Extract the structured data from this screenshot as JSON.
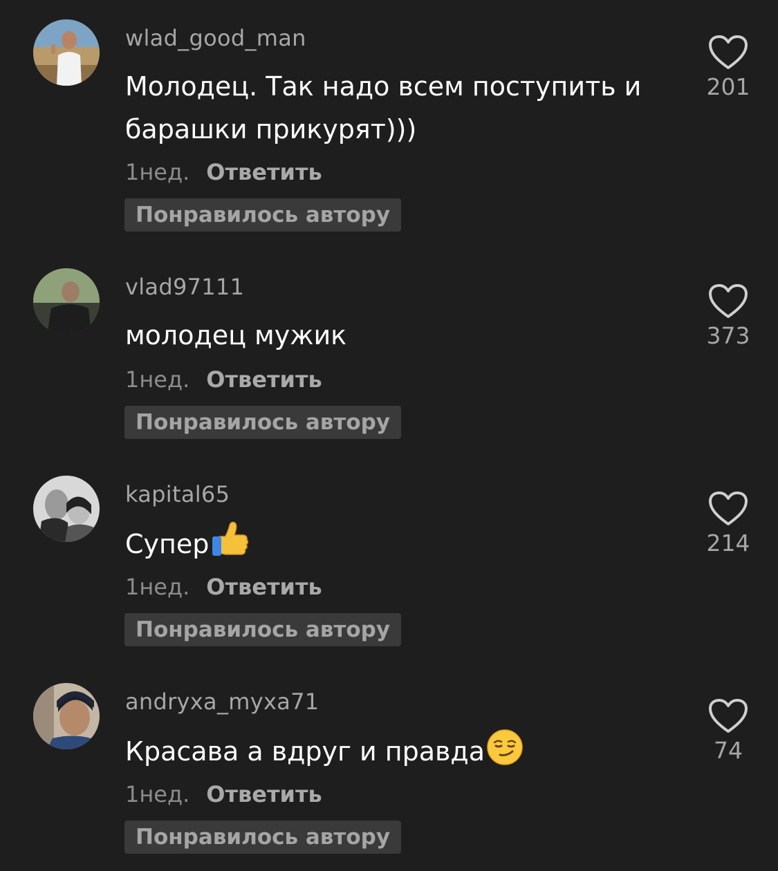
{
  "comments": [
    {
      "username": "wlad_good_man",
      "text": "Молодец. Так надо всем поступить и барашки прикурят)))",
      "emoji": "",
      "time": "1нед.",
      "reply_label": "Ответить",
      "badge": "Понравилось автору",
      "likes": "201",
      "avatar": "avatar-photo"
    },
    {
      "username": "vlad97111",
      "text": "молодец мужик",
      "emoji": "",
      "time": "1нед.",
      "reply_label": "Ответить",
      "badge": "Понравилось автору",
      "likes": "373",
      "avatar": "avatar-photo"
    },
    {
      "username": "kapital65",
      "text": "Супер",
      "emoji": "thumbs-up-emoji",
      "time": "1нед.",
      "reply_label": "Ответить",
      "badge": "Понравилось автору",
      "likes": "214",
      "avatar": "avatar-photo"
    },
    {
      "username": "andryxa_myxa71",
      "text": "Красава а вдруг и правда",
      "emoji": "smirking-face-emoji",
      "time": "1нед.",
      "reply_label": "Ответить",
      "badge": "Понравилось автору",
      "likes": "74",
      "avatar": "avatar-photo"
    }
  ],
  "colors": {
    "background": "#1e1e1e",
    "text": "#ffffff",
    "secondary": "#a7a7a7",
    "badge_bg": "#3a3a3a"
  }
}
